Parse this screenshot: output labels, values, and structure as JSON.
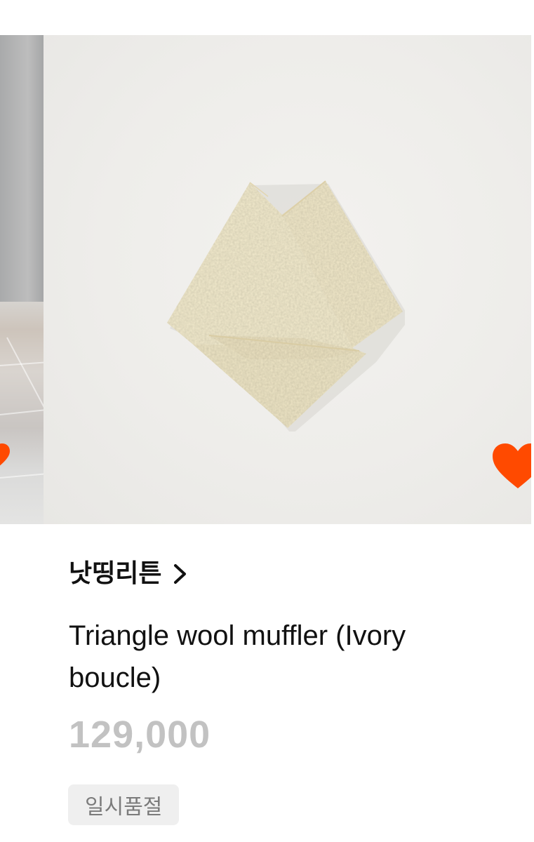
{
  "product": {
    "brand": "낫띵리튼",
    "title": "Triangle wool muffler (Ivory boucle)",
    "price": "129,000",
    "status_badge": "일시품절"
  },
  "icons": {
    "wishlist": "heart-icon",
    "brand_link": "chevron-right-icon"
  },
  "colors": {
    "heart": "#ff4a00",
    "price": "#c2c2c2",
    "badge_bg": "#efefef",
    "badge_text": "#7b7b7b"
  }
}
